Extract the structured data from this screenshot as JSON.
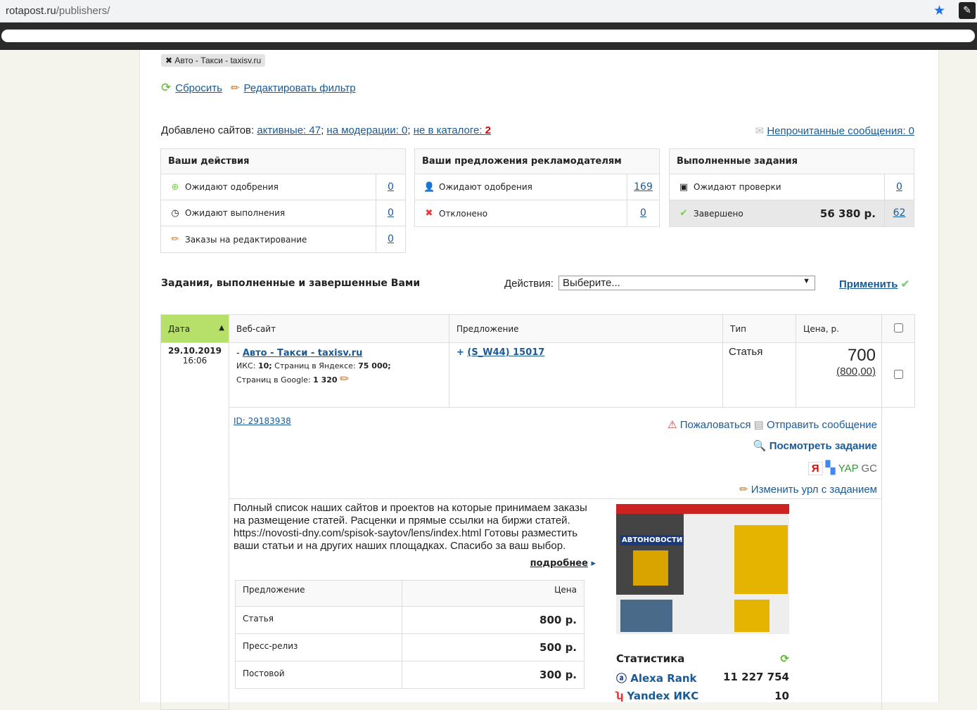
{
  "browser": {
    "url_host": "rotapost.ru",
    "url_path": "/publishers/"
  },
  "filter": {
    "tag": "Авто - Такси - taxisv.ru",
    "reset": "Сбросить",
    "edit": "Редактировать фильтр"
  },
  "sites": {
    "label": "Добавлено сайтов:",
    "active": "активные: 47",
    "moderation": "на модерации: 0",
    "not_catalog_label": "не в каталоге:",
    "not_catalog_count": "2",
    "sep": ";",
    "unread": "Непрочитанные сообщения: 0"
  },
  "actions_box": {
    "title": "Ваши действия",
    "rows": [
      {
        "label": "Ожидают одобрения",
        "value": "0"
      },
      {
        "label": "Ожидают выполнения",
        "value": "0"
      },
      {
        "label": "Заказы на редактирование",
        "value": "0"
      }
    ]
  },
  "offers_box": {
    "title": "Ваши предложения рекламодателям",
    "rows": [
      {
        "label": "Ожидают одобрения",
        "value": "169"
      },
      {
        "label": "Отклонено",
        "value": "0"
      }
    ]
  },
  "done_box": {
    "title": "Выполненные задания",
    "rows": [
      {
        "label": "Ожидают проверки",
        "value": "0"
      },
      {
        "label": "Завершено",
        "amount": "56 380 р.",
        "value": "62"
      }
    ]
  },
  "section": {
    "title": "Задания, выполненные и завершенные Вами",
    "actions_label": "Действия:",
    "select_value": "Выберите...",
    "apply": "Применить"
  },
  "table": {
    "headers": [
      "Дата",
      "Веб-сайт",
      "Предложение",
      "Тип",
      "Цена, р."
    ],
    "row": {
      "date": "29.10.2019",
      "time": "16:06",
      "site": "Авто - Такси - taxisv.ru",
      "iks_label": "ИКС:",
      "iks": "10;",
      "yandex_label": "Страниц в Яндексе:",
      "yandex": "75 000;",
      "google_label": "Страниц в Google:",
      "google": "1 320",
      "offer": "(S_W44) 15017",
      "type": "Статья",
      "price": "700",
      "price_old": "(800,00)",
      "id": "ID: 29183938",
      "complain": "Пожаловаться",
      "send": "Отправить сообщение",
      "view": "Посмотреть задание",
      "yap": "YAP",
      "gc": "GC",
      "change_url": "Изменить урл с заданием"
    }
  },
  "details": {
    "text": "Полный список наших сайтов и проектов на которые принимаем заказы на размещение статей. Расценки и прямые ссылки на биржи статей. https://novosti-dny.com/spisok-saytov/lens/index.html Готовы разместить ваши статьи и на других наших площадках. Спасибо за ваш выбор.",
    "more": "подробнее",
    "price_table": {
      "headers": [
        "Предложение",
        "Цена"
      ],
      "rows": [
        {
          "name": "Статья",
          "price": "800 р."
        },
        {
          "name": "Пресс-релиз",
          "price": "500 р."
        },
        {
          "name": "Постовой",
          "price": "300 р."
        }
      ]
    },
    "thumb_logo": "АВТОНОВОСТИ",
    "stats": {
      "title": "Статистика",
      "rows": [
        {
          "name": "Alexa Rank",
          "value": "11 227 754"
        },
        {
          "name": "Yandex ИКС",
          "value": "10"
        }
      ]
    }
  }
}
